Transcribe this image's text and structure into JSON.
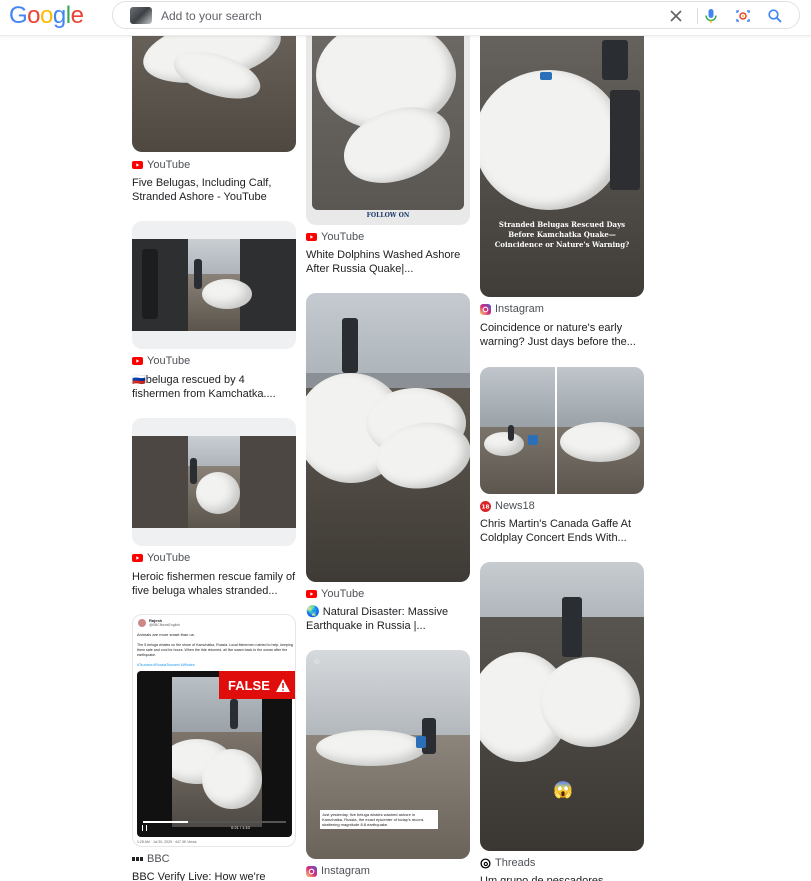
{
  "header": {
    "logo": [
      "G",
      "o",
      "o",
      "g",
      "l",
      "e"
    ],
    "logo_colors": [
      "#4285F4",
      "#EA4335",
      "#FBBC05",
      "#4285F4",
      "#34A853",
      "#EA4335"
    ],
    "search_placeholder": "Add to your search"
  },
  "icons": {
    "youtube": "youtube-icon",
    "instagram": "instagram-icon",
    "news18": "news18-icon",
    "bbc": "bbc-icon",
    "threads": "threads-icon"
  },
  "col1": [
    {
      "source": "YouTube",
      "title": "Five Belugas, Including Calf, Stranded Ashore - YouTube"
    },
    {
      "source": "YouTube",
      "title": "🇷🇺beluga rescued by 4 fishermen from Kamchatka...."
    },
    {
      "source": "YouTube",
      "title": "Heroic fishermen rescue family of five beluga whales stranded..."
    },
    {
      "source": "BBC",
      "title": "BBC Verify Live: How we're",
      "tweet_user": "Rajesh",
      "tweet_handle": "@BBCNewsEnglish",
      "tweet_line1": "Animals are more smart than us.",
      "tweet_line2": "The 5 beluga whales on the shore of Kamchatka, Russia. Local fishermen rushed to help, keeping them safe and cool for hours. When the tide returned, all five swam back to the ocean after the earthquake.",
      "tweet_tags": "#Tsunami #RussiaTsunami #Whales",
      "false_label": "FALSE",
      "video_time": "0:21 / 1:10",
      "tweet_date": "1:28 AM · Jul 30, 2025 · 447.3K Views"
    }
  ],
  "col2": [
    {
      "source": "YouTube",
      "title": "White Dolphins Washed Ashore After Russia Quake|...",
      "banner": "FOLLOW ON"
    },
    {
      "source": "YouTube",
      "title": "🌏 Natural Disaster: Massive Earthquake in Russia |..."
    },
    {
      "source": "Instagram",
      "title": "",
      "caption": "Just yesterday, five beluga whales washed ashore in Kamchatka, Russia, the exact epicenter of today's record-shattering magnitude 8.8 earthquake."
    }
  ],
  "col3": [
    {
      "source": "Instagram",
      "title": "Coincidence or nature's early warning? Just days before the...",
      "overlay": "Stranded Belugas Rescued Days Before Kamchatka Quake—Coincidence or Nature's Warning?"
    },
    {
      "source": "News18",
      "title": "Chris Martin's Canada Gaffe At Coldplay Concert Ends With..."
    },
    {
      "source": "Threads",
      "title": "Um grupo de pescadores",
      "emoji": "😱"
    }
  ]
}
